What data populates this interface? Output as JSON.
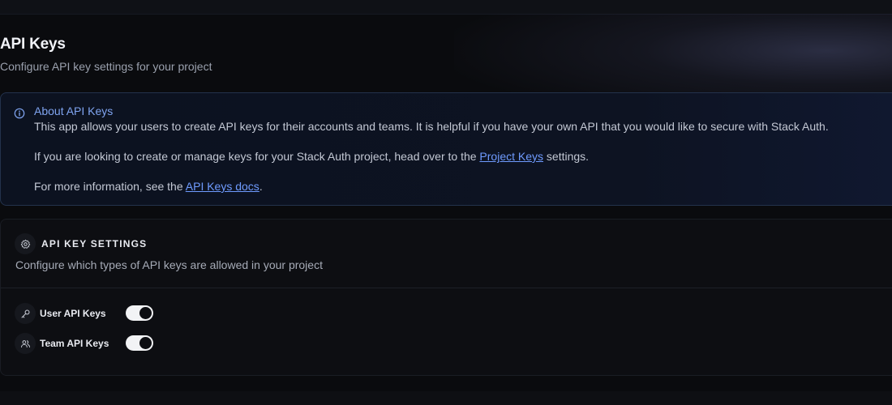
{
  "header": {
    "title": "API Keys",
    "subtitle": "Configure API key settings for your project"
  },
  "info": {
    "icon": "info-icon",
    "title": "About API Keys",
    "line1": "This app allows your users to create API keys for their accounts and teams. It is helpful if you have your own API that you would like to secure with Stack Auth.",
    "line2_before": "If you are looking to create or manage keys for your Stack Auth project, head over to the ",
    "line2_link": "Project Keys",
    "line2_after": " settings.",
    "line3_before": "For more information, see the ",
    "line3_link": "API Keys docs",
    "line3_after": "."
  },
  "settings": {
    "icon": "gear-icon",
    "title": "API KEY SETTINGS",
    "description": "Configure which types of API keys are allowed in your project",
    "rows": [
      {
        "icon": "key-icon",
        "label": "User API Keys",
        "enabled": true
      },
      {
        "icon": "users-icon",
        "label": "Team API Keys",
        "enabled": true
      }
    ]
  },
  "colors": {
    "accent_link": "#6f9bff",
    "info_border": "#23324c",
    "toggle_on": "#f2f3f5"
  }
}
